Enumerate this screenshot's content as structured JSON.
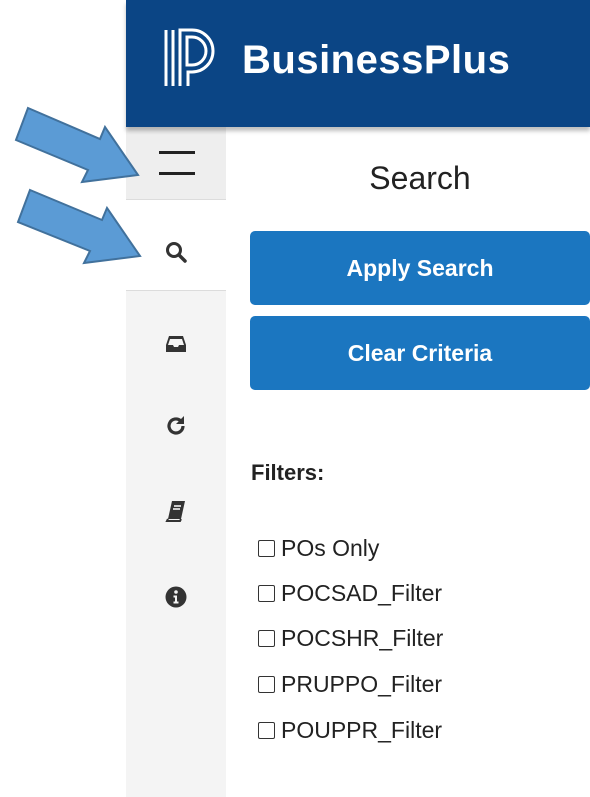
{
  "header": {
    "brand_name": "BusinessPlus",
    "logo_icon": "powerschool-p-logo-icon",
    "background": "#0b4585"
  },
  "sidebar": {
    "items": [
      {
        "icon": "hamburger-menu-icon"
      },
      {
        "icon": "search-icon",
        "active": true
      },
      {
        "icon": "inbox-tray-icon"
      },
      {
        "icon": "refresh-icon"
      },
      {
        "icon": "book-icon"
      },
      {
        "icon": "info-circle-icon"
      }
    ]
  },
  "panel": {
    "title": "Search",
    "apply_button": "Apply Search",
    "clear_button": "Clear Criteria",
    "filters_label": "Filters:",
    "filters": [
      {
        "label": "POs Only",
        "checked": false
      },
      {
        "label": "POCSAD_Filter",
        "checked": false
      },
      {
        "label": "POCSHR_Filter",
        "checked": false
      },
      {
        "label": "PRUPPO_Filter",
        "checked": false
      },
      {
        "label": "POUPPR_Filter",
        "checked": false
      }
    ]
  },
  "annotations": [
    {
      "icon": "pointer-arrow-icon",
      "target": "menu-button",
      "color": "#5b9bd5"
    },
    {
      "icon": "pointer-arrow-icon",
      "target": "search-nav-button",
      "color": "#5b9bd5"
    }
  ],
  "colors": {
    "button": "#1b76c0",
    "sidebar": "#f4f4f4"
  }
}
